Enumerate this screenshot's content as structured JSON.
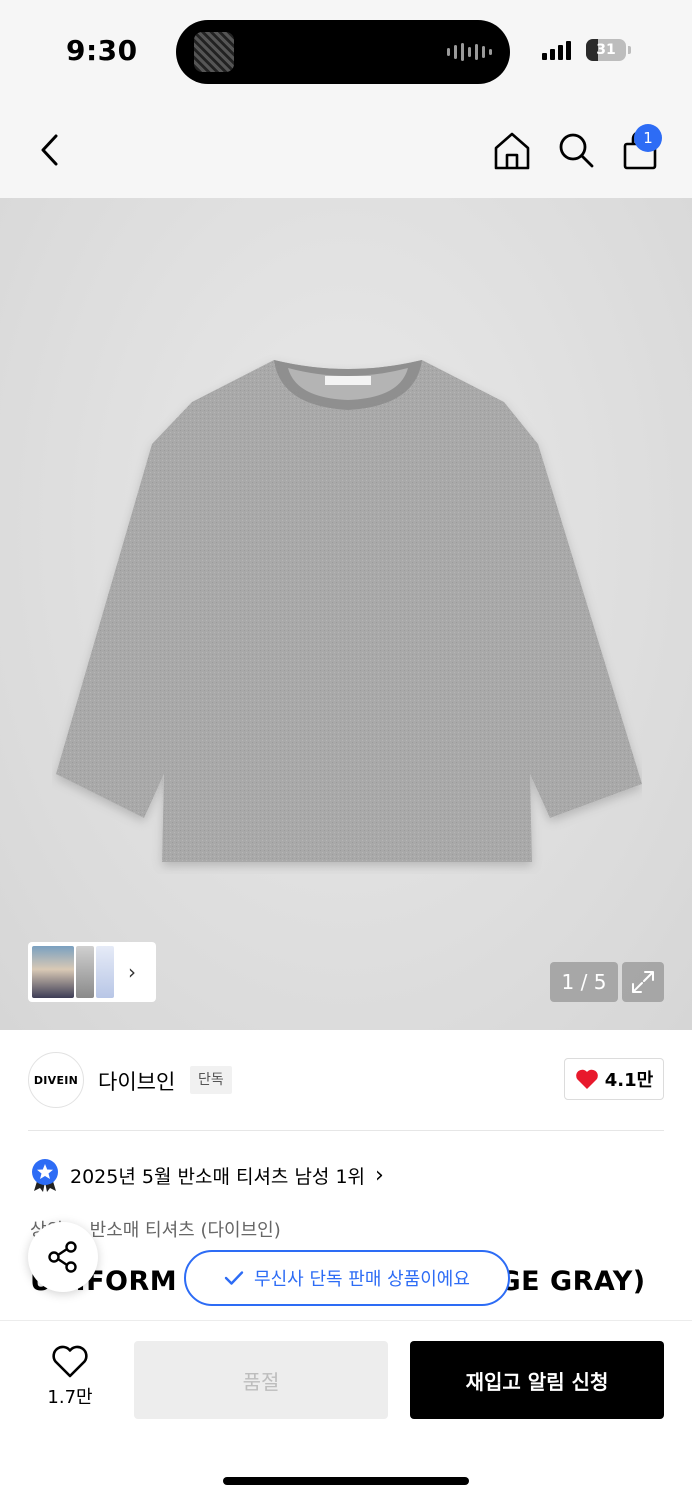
{
  "status_bar": {
    "time": "9:30",
    "battery": "31",
    "battery_level": 0.31
  },
  "nav": {
    "cart_count": "1"
  },
  "product_image": {
    "page_indicator": "1 / 5"
  },
  "brand": {
    "logo_text": "DIVEIN",
    "name": "다이브인",
    "exclusive_tag": "단독",
    "likes": "4.1만"
  },
  "ranking": {
    "text": "2025년 5월 반소매 티셔츠 남성 1위"
  },
  "category": {
    "text": "상의 > 반소매 티셔츠 (다이브인)"
  },
  "product": {
    "title": "UNIFORM OVERFIT TEE (ORANGE GRAY)"
  },
  "toast": {
    "text": "무신사 단독 판매 상품이에요"
  },
  "bottom_bar": {
    "wishlist_count": "1.7만",
    "soldout_label": "품절",
    "restock_label": "재입고 알림 신청"
  },
  "colors": {
    "accent_blue": "#2d6cf5",
    "heart_red": "#e8192c",
    "primary_black": "#000000"
  }
}
